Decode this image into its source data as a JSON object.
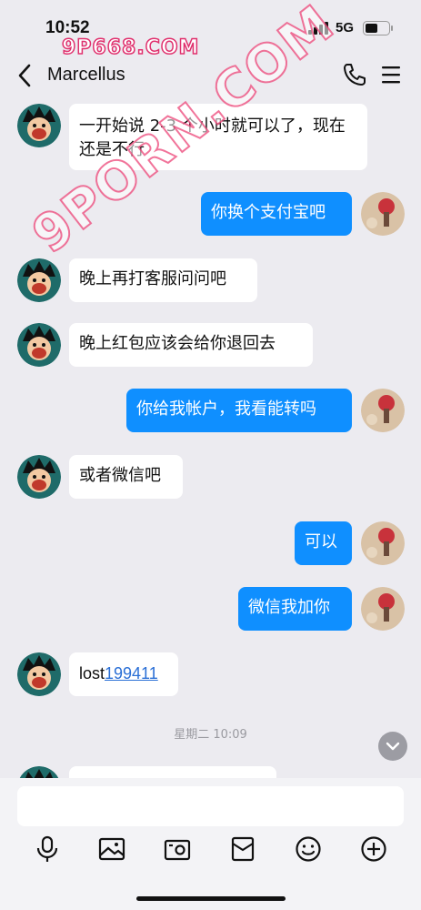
{
  "status_bar": {
    "time": "10:52",
    "network": "5G"
  },
  "watermark_top": "9P668.COM",
  "watermark_mid": "9PORN.COM",
  "nav": {
    "contact_name": "Marcellus"
  },
  "messages": [
    {
      "dir": "in",
      "text": "一开始说 2-3 个小时就可以了，现在还是不行"
    },
    {
      "dir": "out",
      "text": "你换个支付宝吧"
    },
    {
      "dir": "in",
      "text": "晚上再打客服问问吧"
    },
    {
      "dir": "in",
      "text": "晚上红包应该会给你退回去"
    },
    {
      "dir": "out",
      "text": "你给我帐户，我看能转吗"
    },
    {
      "dir": "in",
      "text": "或者微信吧"
    },
    {
      "dir": "out",
      "text": "可以"
    },
    {
      "dir": "out",
      "text": "微信我加你"
    },
    {
      "dir": "in",
      "text_prefix": "lost",
      "text_link": "199411"
    }
  ],
  "timestamp": "星期二 10:09",
  "input": {
    "placeholder": ""
  },
  "toolbar": {
    "icons": [
      "microphone-icon",
      "image-icon",
      "camera-icon",
      "wallet-icon",
      "emoji-icon",
      "plus-icon"
    ]
  },
  "colors": {
    "outgoing_bubble": "#0f8fff",
    "incoming_bubble": "#ffffff",
    "background": "#ecebf0"
  }
}
